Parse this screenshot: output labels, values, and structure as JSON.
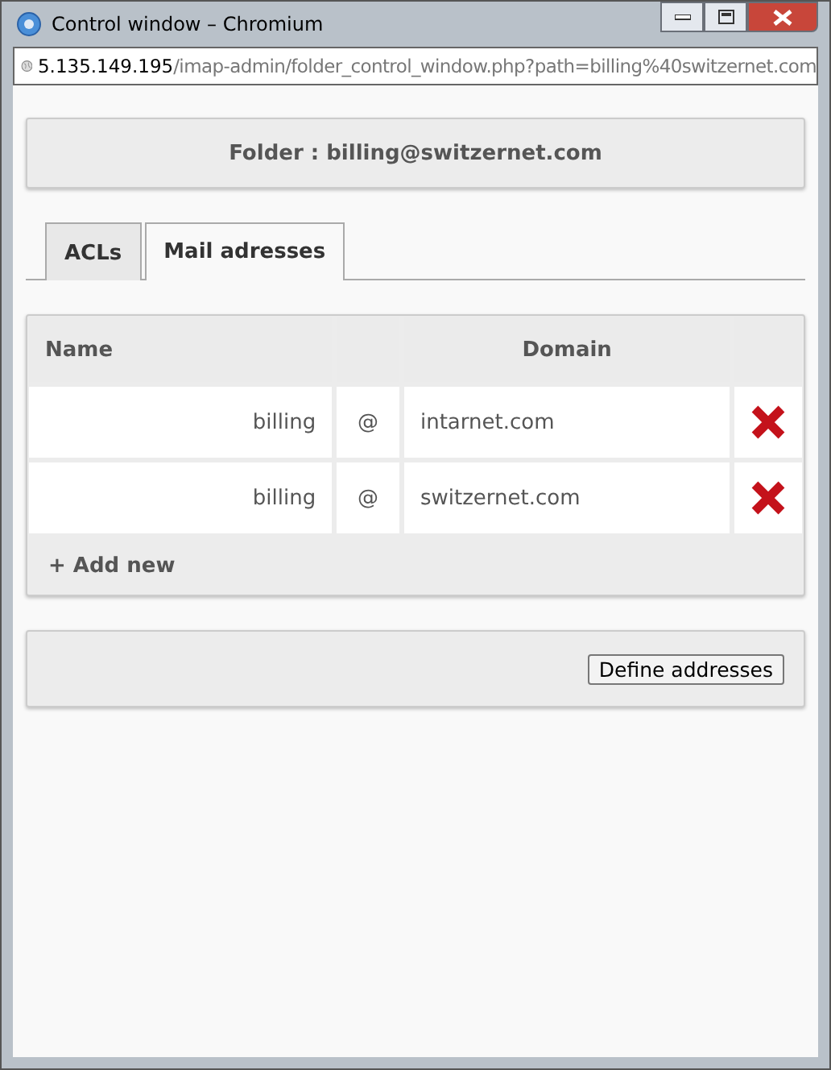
{
  "window": {
    "title": "Control window – Chromium"
  },
  "address_bar": {
    "host": "5.135.149.195",
    "path": "/imap-admin/folder_control_window.php?path=billing%40switzernet.com"
  },
  "folder_header": "Folder : billing@switzernet.com",
  "tabs": [
    {
      "label": "ACLs",
      "selected": false
    },
    {
      "label": "Mail adresses",
      "selected": true
    }
  ],
  "table": {
    "columns": [
      "Name",
      "Domain"
    ],
    "rows": [
      {
        "name": "billing",
        "at": "@",
        "domain": "intarnet.com"
      },
      {
        "name": "billing",
        "at": "@",
        "domain": "switzernet.com"
      }
    ],
    "add_new": "+ Add new"
  },
  "buttons": [
    "Define addresses"
  ]
}
